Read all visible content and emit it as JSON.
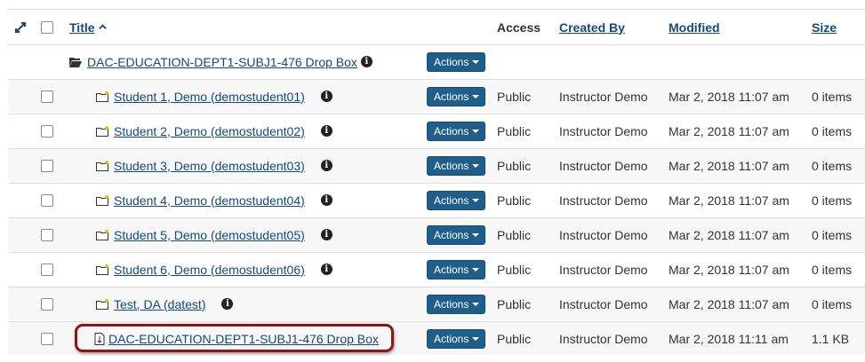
{
  "header": {
    "title": "Title",
    "access": "Access",
    "created_by": "Created By",
    "modified": "Modified",
    "size": "Size"
  },
  "actions_label": "Actions",
  "dropbox_folder": {
    "title": "DAC-EDUCATION-DEPT1-SUBJ1-476 Drop Box"
  },
  "rows": [
    {
      "title": "Student 1, Demo (demostudent01) ",
      "access": "Public",
      "created_by": "Instructor Demo",
      "modified": "Mar 2, 2018 11:07 am",
      "size": "0 items"
    },
    {
      "title": "Student 2, Demo (demostudent02) ",
      "access": "Public",
      "created_by": "Instructor Demo",
      "modified": "Mar 2, 2018 11:07 am",
      "size": "0 items"
    },
    {
      "title": "Student 3, Demo (demostudent03) ",
      "access": "Public",
      "created_by": "Instructor Demo",
      "modified": "Mar 2, 2018 11:07 am",
      "size": "0 items"
    },
    {
      "title": "Student 4, Demo (demostudent04) ",
      "access": "Public",
      "created_by": "Instructor Demo",
      "modified": "Mar 2, 2018 11:07 am",
      "size": "0 items"
    },
    {
      "title": "Student 5, Demo (demostudent05) ",
      "access": "Public",
      "created_by": "Instructor Demo",
      "modified": "Mar 2, 2018 11:07 am",
      "size": "0 items"
    },
    {
      "title": "Student 6, Demo (demostudent06) ",
      "access": "Public",
      "created_by": "Instructor Demo",
      "modified": "Mar 2, 2018 11:07 am",
      "size": "0 items"
    },
    {
      "title": "Test, DA (datest) ",
      "access": "Public",
      "created_by": "Instructor Demo",
      "modified": "Mar 2, 2018 11:07 am",
      "size": "0 items"
    }
  ],
  "file_row": {
    "title": "DAC-EDUCATION-DEPT1-SUBJ1-476 Drop Box",
    "access": "Public",
    "created_by": "Instructor Demo",
    "modified": "Mar 2, 2018 11:11 am",
    "size": "1.1 KB"
  },
  "colors": {
    "link": "#15497b",
    "actions_button": "#1f5d8a",
    "highlight": "#8c1515",
    "stripe": "#f7f7f7"
  }
}
